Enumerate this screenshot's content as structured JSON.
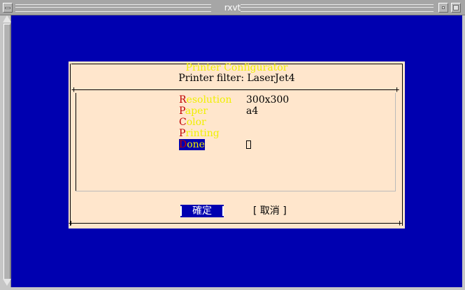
{
  "window": {
    "title": "rxvt"
  },
  "dialog": {
    "title": "Printer Configurator",
    "subtitle": "Printer filter: LaserJet4",
    "menu": [
      {
        "hotkey": "R",
        "rest": "esolution",
        "value": "300x300"
      },
      {
        "hotkey": "P",
        "rest": "aper",
        "value": "a4"
      },
      {
        "hotkey": "C",
        "rest": "olor",
        "value": ""
      },
      {
        "hotkey": "P",
        "rest": "rinting",
        "value": ""
      },
      {
        "hotkey": "D",
        "rest": "one",
        "value": "",
        "selected": true
      }
    ],
    "buttons": {
      "ok": "確定",
      "cancel": "[ 取消 ]"
    }
  },
  "colors": {
    "terminal_bg": "#0000b0",
    "dialog_bg": "#ffe6cc",
    "hotkey": "#c00000",
    "highlight_text": "#f0f000"
  }
}
